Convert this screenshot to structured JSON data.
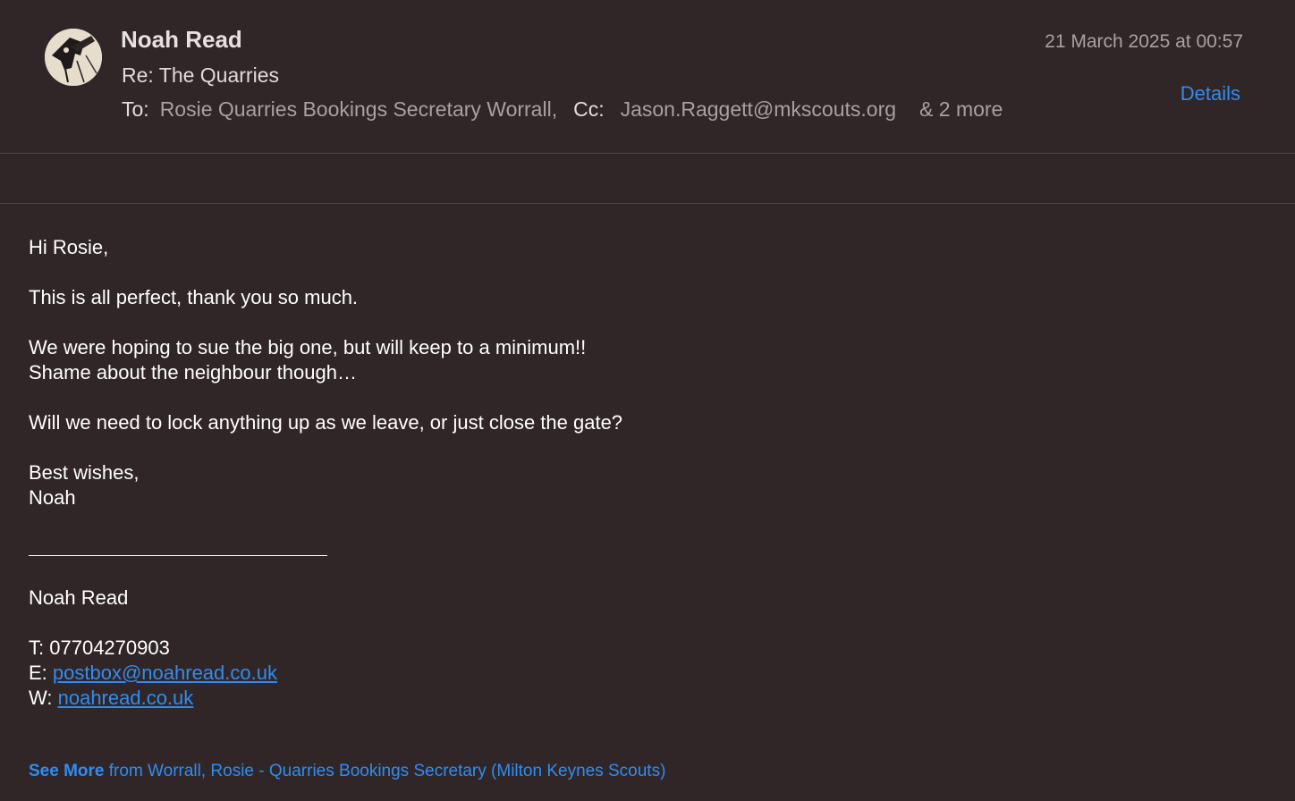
{
  "header": {
    "sender": "Noah Read",
    "subject": "Re: The Quarries",
    "to_label": "To:",
    "to_value": "Rosie Quarries Bookings Secretary Worrall,",
    "cc_label": "Cc:",
    "cc_value": "Jason.Raggett@mkscouts.org",
    "more": "& 2 more",
    "date": "21 March 2025 at 00:57",
    "details_label": "Details",
    "avatar_icon": "sender-avatar-icon"
  },
  "body": {
    "greeting": "Hi Rosie,",
    "p1": "This is all perfect, thank you so much.",
    "p2_line1": "We were hoping to sue the big one, but will keep to a minimum!!",
    "p2_line2": "Shame about the neighbour though…",
    "p3": "Will we need to lock anything up as we leave, or just close the gate?",
    "signoff1": "Best wishes,",
    "signoff2": "Noah"
  },
  "signature": {
    "name": "Noah Read",
    "phone_label": "T:",
    "phone": "07704270903",
    "email_label": "E:",
    "email": "postbox@noahread.co.uk",
    "web_label": "W:",
    "web": "noahread.co.uk"
  },
  "see_more": {
    "label": "See More",
    "text": "from Worrall, Rosie - Quarries Bookings Secretary (Milton Keynes Scouts)"
  },
  "colors": {
    "background": "#302628",
    "accent": "#2f8df2",
    "muted": "#a8a0a2"
  }
}
